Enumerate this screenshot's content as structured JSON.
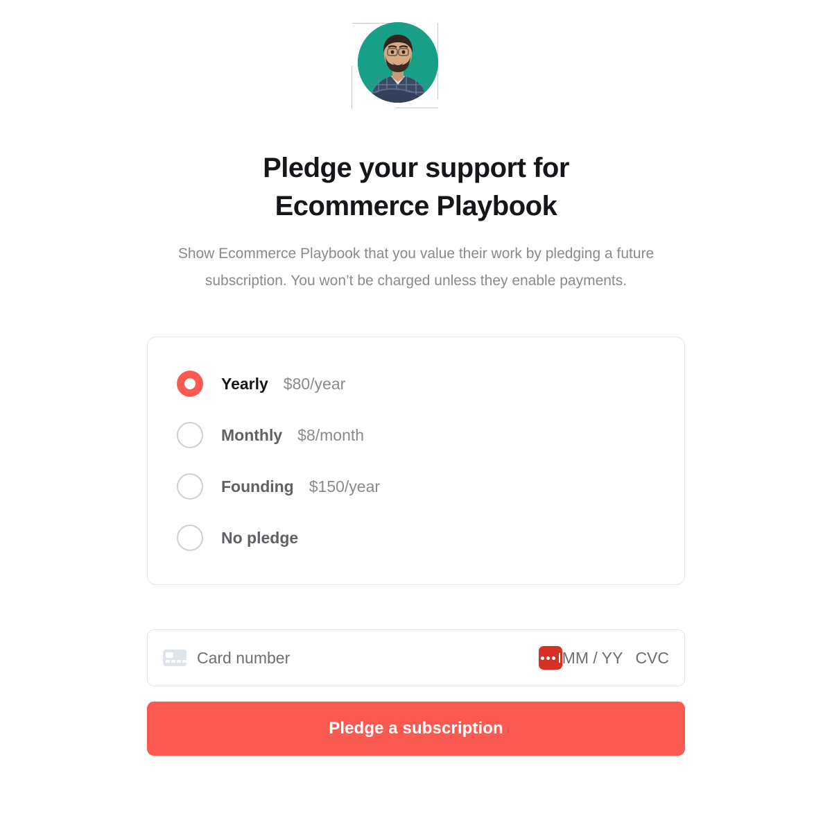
{
  "avatar": {
    "icon": "user-photo-avatar",
    "background_color": "#17a085",
    "alt": "Creator profile photo"
  },
  "heading": {
    "title": "Pledge your support for Ecommerce Playbook",
    "line1": "Pledge your support for",
    "line2": "Ecommerce Playbook"
  },
  "subtitle": {
    "text": "Show Ecommerce Playbook that you value their work by pledging a future subscription. You won’t be charged unless they enable payments."
  },
  "plans": {
    "selected": "Yearly",
    "options": [
      {
        "label": "Yearly",
        "price": "$80/year",
        "selected": true
      },
      {
        "label": "Monthly",
        "price": "$8/month",
        "selected": false
      },
      {
        "label": "Founding",
        "price": "$150/year",
        "selected": false
      },
      {
        "label": "No pledge",
        "price": "",
        "selected": false
      }
    ]
  },
  "payment": {
    "card_icon": "credit-card-icon",
    "card_number_placeholder": "Card number",
    "card_number_value": "",
    "brand_icon": "masked-input-icon",
    "expiry_placeholder": "MM / YY",
    "expiry_value": "",
    "cvc_placeholder": "CVC",
    "cvc_value": ""
  },
  "submit": {
    "label": "Pledge a subscription"
  },
  "colors": {
    "accent": "#fb5a52",
    "brand_icon": "#d93025",
    "avatar_bg": "#17a085",
    "text_primary": "#15161a",
    "text_secondary": "#8a8a8e",
    "border": "#e6e6e6"
  }
}
